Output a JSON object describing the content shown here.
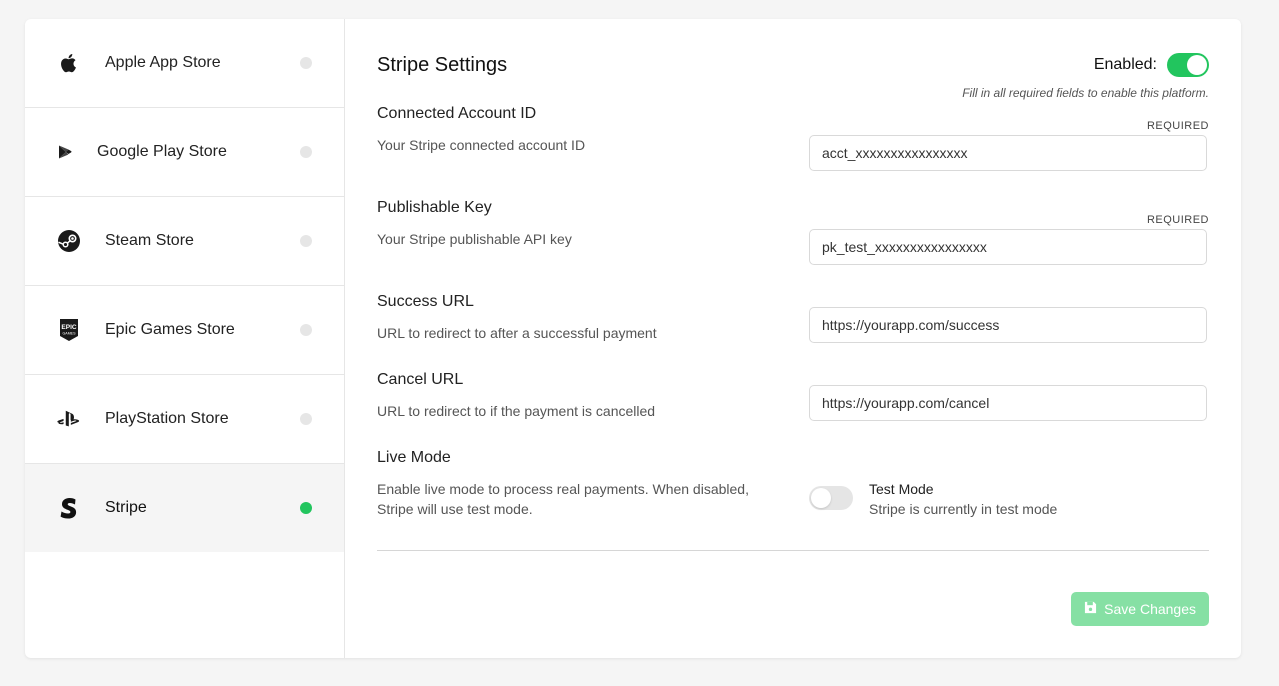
{
  "sidebar": {
    "items": [
      {
        "label": "Apple App Store",
        "icon": "apple-icon",
        "active": false
      },
      {
        "label": "Google Play Store",
        "icon": "google-play-icon",
        "active": false
      },
      {
        "label": "Steam Store",
        "icon": "steam-icon",
        "active": false
      },
      {
        "label": "Epic Games Store",
        "icon": "epic-games-icon",
        "active": false
      },
      {
        "label": "PlayStation Store",
        "icon": "playstation-icon",
        "active": false
      },
      {
        "label": "Stripe",
        "icon": "stripe-icon",
        "active": true
      }
    ]
  },
  "main": {
    "title": "Stripe Settings",
    "enabled_label": "Enabled:",
    "enabled": true,
    "hint": "Fill in all required fields to enable this platform.",
    "required_label": "REQUIRED",
    "fields": [
      {
        "label": "Connected Account ID",
        "desc": "Your Stripe connected account ID",
        "value": "acct_xxxxxxxxxxxxxxxx",
        "required": true
      },
      {
        "label": "Publishable Key",
        "desc": "Your Stripe publishable API key",
        "value": "pk_test_xxxxxxxxxxxxxxxx",
        "required": true
      },
      {
        "label": "Success URL",
        "desc": "URL to redirect to after a successful payment",
        "value": "https://yourapp.com/success",
        "required": false
      },
      {
        "label": "Cancel URL",
        "desc": "URL to redirect to if the payment is cancelled",
        "value": "https://yourapp.com/cancel",
        "required": false
      }
    ],
    "live_mode": {
      "label": "Live Mode",
      "desc_line1": "Enable live mode to process real payments. When disabled,",
      "desc_line2": "Stripe will use test mode.",
      "mode_title": "Test Mode",
      "mode_sub": "Stripe is currently in test mode",
      "on": false
    },
    "save_label": "Save Changes"
  },
  "colors": {
    "accent": "#22c55e",
    "accent_disabled": "#86e0a4",
    "inactive_dot": "#e6e6e6"
  }
}
